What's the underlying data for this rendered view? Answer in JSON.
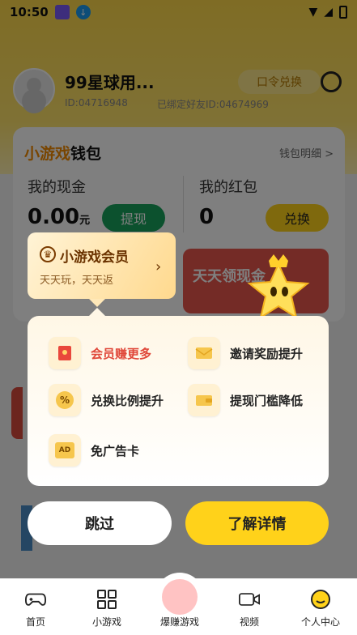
{
  "status_bar": {
    "time": "10:50"
  },
  "profile": {
    "name": "99星球用...",
    "id_text": "ID:04716948",
    "bind_text": "已绑定好友ID:04674969",
    "code_button": "口令兑换"
  },
  "wallet": {
    "title_highlight": "小游戏",
    "title_rest": "钱包",
    "detail_link": "钱包明细 >",
    "cash_label": "我的现金",
    "cash_value": "0.00",
    "cash_unit": "元",
    "withdraw_label": "提现",
    "redpacket_label": "我的红包",
    "redpacket_value": "0",
    "exchange_label": "兑换"
  },
  "banner": {
    "text": "天天领现金"
  },
  "vip_popup": {
    "title": "小游戏会员",
    "subtitle": "天天玩，天天返",
    "benefits": [
      {
        "label": "会员赚更多",
        "icon": "red-packet-icon",
        "accent": true
      },
      {
        "label": "邀请奖励提升",
        "icon": "envelope-icon",
        "accent": false
      },
      {
        "label": "兑换比例提升",
        "icon": "percent-coin-icon",
        "accent": false,
        "glyph": "%"
      },
      {
        "label": "提现门槛降低",
        "icon": "wallet-icon",
        "accent": false
      },
      {
        "label": "免广告卡",
        "icon": "ad-card-icon",
        "accent": false,
        "glyph": "AD"
      }
    ],
    "skip_label": "跳过",
    "detail_label": "了解详情"
  },
  "bottom_nav": {
    "items": [
      {
        "label": "首页",
        "icon": "gamepad-icon"
      },
      {
        "label": "小游戏",
        "icon": "grid-icon"
      },
      {
        "label": "爆赚游戏",
        "icon": "cash-card-icon"
      },
      {
        "label": "视频",
        "icon": "video-icon"
      },
      {
        "label": "个人中心",
        "icon": "smiley-icon"
      }
    ]
  },
  "colors": {
    "brand_yellow": "#ffd21a",
    "accent_red": "#e0483a",
    "vip_brown": "#6b3300",
    "withdraw_green": "#19a35c"
  }
}
